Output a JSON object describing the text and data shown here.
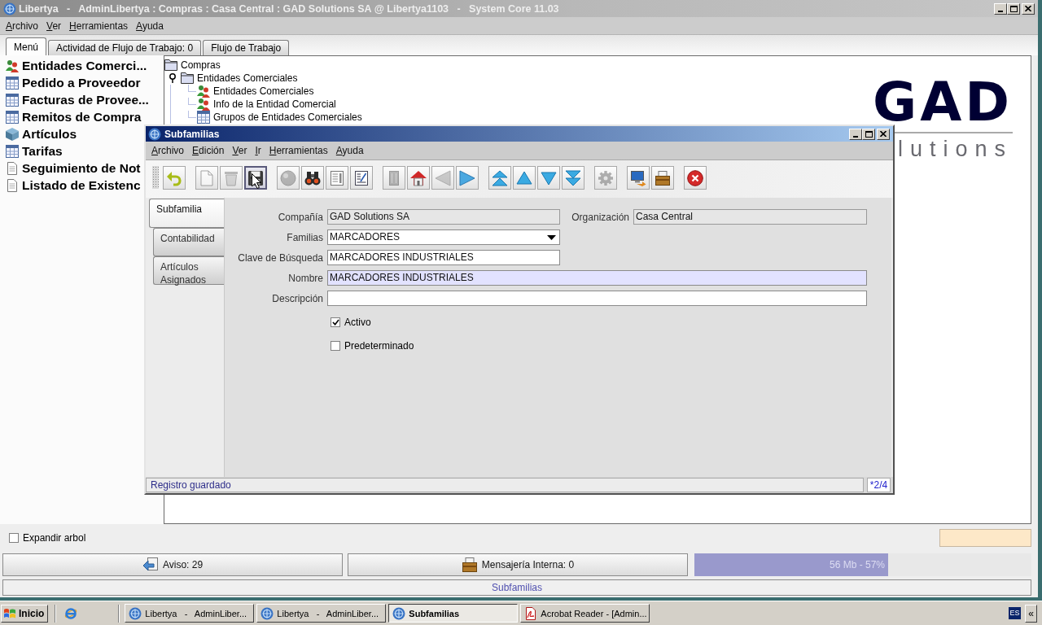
{
  "window": {
    "title": "Libertya   -   AdminLibertya : Compras : Casa Central : GAD Solutions SA @ Libertya1103   -   System Core 11.03"
  },
  "menu": [
    "Archivo",
    "Ver",
    "Herramientas",
    "Ayuda"
  ],
  "tabs": [
    {
      "label": "Menú",
      "selected": true
    },
    {
      "label": "Actividad de Flujo de Trabajo: 0",
      "selected": false
    },
    {
      "label": "Flujo de Trabajo",
      "selected": false
    }
  ],
  "sidebar": {
    "items": [
      {
        "label": "Entidades Comerci...",
        "kind": "partners"
      },
      {
        "label": "Pedido a Proveedor",
        "kind": "window"
      },
      {
        "label": "Facturas de Provee...",
        "kind": "window"
      },
      {
        "label": "Remitos de Compra",
        "kind": "window"
      },
      {
        "label": "Artículos",
        "kind": "product"
      },
      {
        "label": "Tarifas",
        "kind": "window"
      },
      {
        "label": "Seguimiento de Not",
        "kind": "report"
      },
      {
        "label": "Listado de Existenc",
        "kind": "report"
      }
    ]
  },
  "tree": [
    {
      "label": "Compras",
      "kind": "folder",
      "children": [
        {
          "label": "Entidades Comerciales",
          "kind": "folder",
          "expanded": true,
          "children": [
            {
              "label": "Entidades Comerciales",
              "kind": "partners"
            },
            {
              "label": "Info de la Entidad Comercial",
              "kind": "partners"
            },
            {
              "label": "Grupos de Entidades Comerciales",
              "kind": "window"
            }
          ]
        }
      ]
    }
  ],
  "logo": {
    "wordmark": "GAD",
    "tagline": "lutions"
  },
  "dialog": {
    "title": "Subfamilias",
    "menu": [
      "Archivo",
      "Edición",
      "Ver",
      "Ir",
      "Herramientas",
      "Ayuda"
    ],
    "toolbar": [
      [
        {
          "kind": "undo",
          "disabled": false,
          "pressed": false
        }
      ],
      [
        {
          "kind": "new",
          "disabled": true,
          "pressed": false
        },
        {
          "kind": "delete",
          "disabled": true,
          "pressed": false
        },
        {
          "kind": "save",
          "disabled": false,
          "pressed": true
        }
      ],
      [
        {
          "kind": "refresh",
          "disabled": true,
          "pressed": false
        },
        {
          "kind": "find",
          "disabled": false,
          "pressed": false
        },
        {
          "kind": "attachment",
          "disabled": false,
          "pressed": false
        },
        {
          "kind": "report",
          "disabled": false,
          "pressed": false
        }
      ],
      [
        {
          "kind": "history",
          "disabled": true,
          "pressed": false
        },
        {
          "kind": "home",
          "disabled": false,
          "pressed": false
        },
        {
          "kind": "parent",
          "disabled": true,
          "pressed": false
        },
        {
          "kind": "detail",
          "disabled": false,
          "pressed": false
        }
      ],
      [
        {
          "kind": "first",
          "disabled": false,
          "pressed": false
        },
        {
          "kind": "previous",
          "disabled": false,
          "pressed": false
        },
        {
          "kind": "next",
          "disabled": false,
          "pressed": false
        },
        {
          "kind": "last",
          "disabled": false,
          "pressed": false
        }
      ],
      [
        {
          "kind": "zoom",
          "disabled": true,
          "pressed": false
        }
      ],
      [
        {
          "kind": "print",
          "disabled": false,
          "pressed": false
        },
        {
          "kind": "archive",
          "disabled": false,
          "pressed": false
        }
      ],
      [
        {
          "kind": "exit",
          "disabled": false,
          "pressed": false
        }
      ]
    ],
    "side_tabs": [
      {
        "label": "Subfamilia",
        "selected": true
      },
      {
        "label": "Contabilidad",
        "selected": false
      },
      {
        "label": "Artículos Asignados",
        "selected": false
      }
    ],
    "rows": [
      [
        {
          "label": "Compañía",
          "value": "GAD Solutions SA",
          "kind": "text",
          "readonly": true,
          "focused": false,
          "wide": false
        },
        {
          "label": "Organización",
          "value": "Casa Central",
          "kind": "text",
          "readonly": true,
          "focused": false,
          "wide": false
        }
      ],
      [
        {
          "label": "Familias",
          "value": "MARCADORES",
          "kind": "combo",
          "readonly": false,
          "focused": false,
          "wide": false
        }
      ],
      [
        {
          "label": "Clave de Búsqueda",
          "value": "MARCADORES INDUSTRIALES",
          "kind": "text",
          "readonly": false,
          "focused": false,
          "wide": false
        }
      ],
      [
        {
          "label": "Nombre",
          "value": "MARCADORES INDUSTRIALES",
          "kind": "text",
          "readonly": false,
          "focused": true,
          "wide": true
        }
      ],
      [
        {
          "label": "Descripción",
          "kind": "text",
          "readonly": false,
          "focused": false,
          "wide": true
        }
      ]
    ],
    "checkboxes": [
      {
        "label": "Activo",
        "checked": true
      },
      {
        "label": "Predeterminado",
        "checked": false
      }
    ],
    "status": {
      "message": "Registro guardado",
      "record": "*2/4"
    }
  },
  "expand_tree": {
    "label": "Expandir arbol",
    "checked": false
  },
  "status_buttons": [
    {
      "label": "Aviso: 29",
      "kind": "notice"
    },
    {
      "label": "Mensajería Interna: 0",
      "kind": "messages"
    }
  ],
  "memory": {
    "label": "56 Mb - 57%",
    "level": 0.575
  },
  "status_line": "Subfamilias",
  "taskbar": {
    "start": "Inicio",
    "tasks": [
      {
        "label": "Libertya   -   AdminLiber...",
        "kind": "libertya",
        "selected": false
      },
      {
        "label": "Libertya   -   AdminLiber...",
        "kind": "libertya",
        "selected": false
      },
      {
        "label": "Subfamilias",
        "kind": "libertya",
        "selected": true
      },
      {
        "label": "Acrobat Reader - [Admin...",
        "kind": "acrobat",
        "selected": false
      }
    ],
    "language": "ES",
    "tray_toggle": "«"
  }
}
